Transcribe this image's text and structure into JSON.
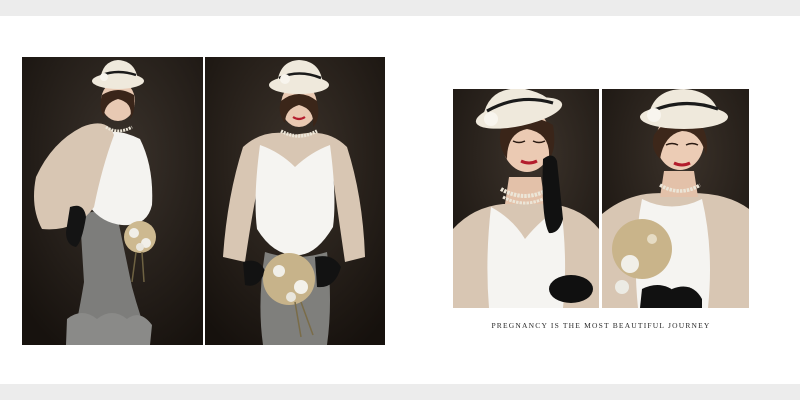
{
  "spread": {
    "caption": "PREGNANCY IS THE MOST BEAUTIFUL JOURNEY"
  },
  "colors": {
    "frame_band": "#ececec",
    "page": "#ffffff",
    "photo_backdrop": "#1f1a15",
    "hat_cream": "#efe9dc",
    "dress_white": "#f5f4f1",
    "cardigan_beige": "#d8c6b3",
    "skirt_grey": "#7d7d7b",
    "pearls": "#ece6d8"
  },
  "photos": [
    {
      "name": "photo-full-length-side"
    },
    {
      "name": "photo-three-quarter-front"
    },
    {
      "name": "photo-closeup-eyes-closed"
    },
    {
      "name": "photo-closeup-over-shoulder"
    }
  ]
}
